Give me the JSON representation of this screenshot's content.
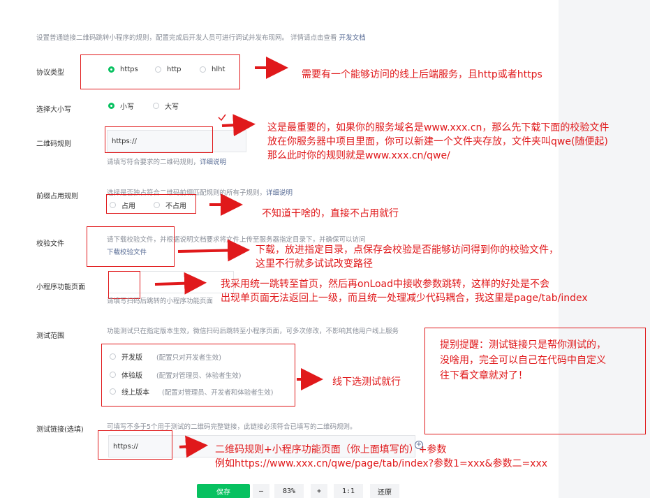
{
  "form": {
    "intro": "设置普通链接二维码跳转小程序的规则，配置完成后开发人员可进行调试并发布现网。 详情请点击查看",
    "intro_link": "开发文档",
    "protocol": {
      "label": "协议类型",
      "options": [
        "https",
        "http",
        "hlht"
      ],
      "selected": "https"
    },
    "case": {
      "label": "选择大小写",
      "options": [
        "小写",
        "大写"
      ],
      "selected": "小写"
    },
    "qr_rule": {
      "label": "二维码规则",
      "prefix": "https://",
      "hint": "请填写符合要求的二维码规则，",
      "hint_link": "详细说明"
    },
    "prefix_rule": {
      "label": "前缀占用规则",
      "hint": "选择是否独占符合二维码前缀匹配规则的所有子规则，",
      "hint_link": "详细说明",
      "options": [
        "占用",
        "不占用"
      ]
    },
    "verify_file": {
      "label": "校验文件",
      "hint": "请下载校验文件，并根据说明文档要求将文件上传至服务器指定目录下，并确保可以访问",
      "download_link": "下载校验文件"
    },
    "mp_page": {
      "label": "小程序功能页面",
      "hint": "请填写扫码后跳转的小程序功能页面"
    },
    "test_scope": {
      "label": "测试范围",
      "hint": "功能测试只在指定版本生效，微信扫码后跳转至小程序页面，可多次修改，不影响其他用户线上服务",
      "options": [
        {
          "name": "开发版",
          "desc": "(配置只对开发者生效)"
        },
        {
          "name": "体验版",
          "desc": "(配置对管理员、体验者生效)"
        },
        {
          "name": "线上版本",
          "desc": "(配置对管理员、开发者和体验者生效)"
        }
      ]
    },
    "test_link": {
      "label": "测试链接(选填)",
      "hint": "可填写不多于5个用于测试的二维码完整链接，此链接必须符合已填写的二维码规则。",
      "prefix": "https://"
    }
  },
  "toolbar": {
    "save": "保存",
    "minus": "—",
    "zoom": "83%",
    "plus": "+",
    "one_to_one": "1:1",
    "reset": "还原"
  },
  "notes": {
    "n1": "需要有一个能够访问的线上后端服务，且http或者https",
    "n2": [
      "这是最重要的，如果你的服务域名是www.xxx.cn，那么先下载下面的校验文件",
      "放在你服务器中项目里面，你可以新建一个文件夹存放，文件夹叫qwe(随便起)",
      "那么此时你的规则就是www.xxx.cn/qwe/"
    ],
    "n3": "不知道干啥的，直接不占用就行",
    "n4": [
      "下载，放进指定目录，点保存会校验是否能够访问得到你的校验文件，",
      "这里不行就多试试改变路径"
    ],
    "n5": [
      "我采用统一跳转至首页，然后再onLoad中接收参数跳转，这样的好处是不会",
      "出现单页面无法返回上一级，而且统一处理减少代码耦合，我这里是page/tab/index"
    ],
    "n6": [
      "提别提醒：测试链接只是帮你测试的，",
      "没啥用，完全可以自己在代码中自定义",
      "往下看文章就对了！"
    ],
    "n7": "线下选测试就行",
    "n8": [
      "二维码规则+小程序功能页面（你上面填写的）+参数",
      "例如https://www.xxx.cn/qwe/page/tab/index?参数1=xxx&参数二=xxx"
    ]
  },
  "colors": {
    "accent": "#07c160",
    "annotation": "#e0191b",
    "link": "#576b95"
  }
}
